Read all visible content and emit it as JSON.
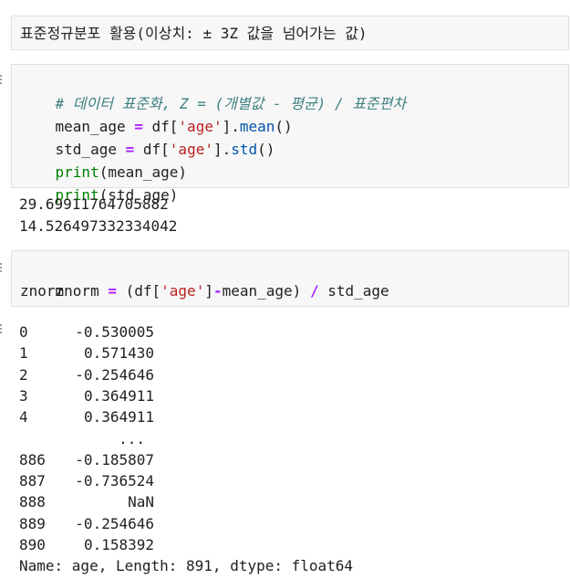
{
  "markdown_cell": {
    "text": "표준정규분포 활용(이상치: ± 3Z 값을 넘어가는 값)"
  },
  "code_cell_1": {
    "comment": "# 데이터 표준화, Z = (개별값 - 평균) / 표준편차",
    "line2": {
      "name": "mean_age",
      "op": "=",
      "obj": "df[",
      "str": "'age'",
      "end": "].",
      "meth": "mean",
      "call": "()"
    },
    "line3": {
      "name": "std_age",
      "op": "=",
      "obj": "df[",
      "str": "'age'",
      "end": "].",
      "meth": "std",
      "call": "()"
    },
    "line4": {
      "kw": "print",
      "arg": "(mean_age)"
    },
    "line5": {
      "kw": "print",
      "arg": "(std_age)"
    }
  },
  "output_1": {
    "line1": "29.69911764705882",
    "line2": "14.526497332334042"
  },
  "code_cell_2": {
    "line1": {
      "name": "znorm",
      "op": "=",
      "open": "(df[",
      "str": "'age'",
      "close": "]",
      "minus": "-",
      "rest": "mean_age)",
      "div": "/",
      "last": "std_age"
    },
    "line2": "znorm"
  },
  "output_2": {
    "rows": [
      {
        "index": "0",
        "value": "-0.530005"
      },
      {
        "index": "1",
        "value": "0.571430"
      },
      {
        "index": "2",
        "value": "-0.254646"
      },
      {
        "index": "3",
        "value": "0.364911"
      },
      {
        "index": "4",
        "value": "0.364911"
      },
      {
        "index": "",
        "value": "..."
      },
      {
        "index": "886",
        "value": "-0.185807"
      },
      {
        "index": "887",
        "value": "-0.736524"
      },
      {
        "index": "888",
        "value": "NaN"
      },
      {
        "index": "889",
        "value": "-0.254646"
      },
      {
        "index": "890",
        "value": "0.158392"
      }
    ],
    "footer": "Name: age, Length: 891, dtype: float64"
  }
}
